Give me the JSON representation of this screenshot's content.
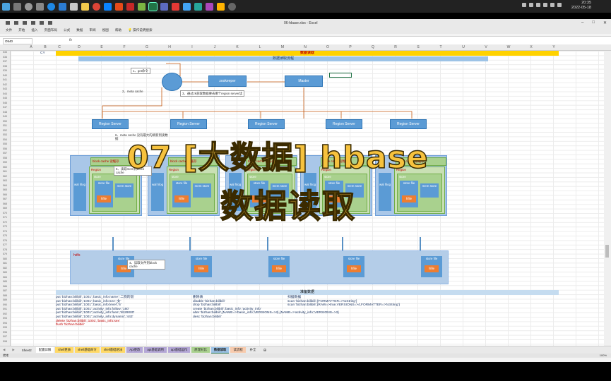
{
  "taskbar": {
    "clock_time": "20:35",
    "clock_date": "2022-05-18"
  },
  "title": {
    "filename": "06-hbase.xlsx",
    "app": "Excel"
  },
  "menu": [
    "文件",
    "开始",
    "插入",
    "页面布局",
    "公式",
    "数据",
    "审阅",
    "视图",
    "帮助",
    "操作说明搜索"
  ],
  "formula": {
    "namebox": "O540",
    "fx": "fx"
  },
  "columns": [
    "A",
    "B",
    "C",
    "D",
    "E",
    "F",
    "G",
    "H",
    "I",
    "J",
    "K",
    "L",
    "M",
    "N",
    "O",
    "P",
    "Q",
    "R",
    "S",
    "T",
    "U",
    "V",
    "W",
    "X",
    "Y"
  ],
  "rows_first": 535,
  "cell_cy": "CY",
  "diagram": {
    "top_title": "数据读取",
    "sub_title": "数据读取流程",
    "client": "",
    "zookeeper": "zookeeper",
    "master": "Master",
    "step1": "1、get命令",
    "step2": "2、meta cache",
    "step3": "3、通过zk获取数据要去哪个region server读",
    "step4": "4、读取文件到block cache",
    "step5": "5、读取mem到block cache",
    "step6": "6、meta cache 没有最大的刷新到读数据",
    "region_server": "Region Server",
    "block_cache": "block cache 读缓存",
    "region": "Region",
    "store": "store",
    "wal": "wal hlog",
    "store_file": "store file",
    "hfile": "hfile",
    "mem_store": "mem store",
    "hdfs": "hdfs"
  },
  "data_section": {
    "title": "准备数据",
    "col1": [
      "put 'bizhan:bilibili','1001','basic_info:name','二狗的饭'",
      "put 'bizhan:bilibili','1001','basic_info:sex','女'",
      "put 'bizhan:bilibili','1001','basic_info:level','6'",
      "put 'bizhan:bilibili','1001','activity_info:follow','160'",
      "put 'bizhan:bilibili','1001','activity_info:fans','4b29000'",
      "put 'bizhan:bilibili','1001','activity_info:dynamic','443'",
      "delete 'bizhan:bilibili','1001','basic_info:sex'",
      "flush 'bizhan:bilibili'"
    ],
    "col2": [
      "删除表",
      "disable 'bizhan:bilibili'",
      "drop 'bizhan:bilibili'",
      "create 'bizhan:bilibili','basic_info','activity_info'",
      "alter 'bizhan:bilibili',{NAME=>'basic_info',VERSIONS=>3},{NAME=>'activity_info',VERSIONS=>3}",
      "desc 'bizhan:bilibili'"
    ],
    "col3": [
      "扫描数据",
      "scan 'bizhan:bilibili',{FORMATTER=>'toString'}",
      "scan 'bizhan:bilibili',{RAW=>true,VERSIONS=>4,FORMATTER=>'toString'}"
    ]
  },
  "overlay": {
    "line1": "07 [大数据] hbase",
    "line2": "数据读取"
  },
  "sheet_tabs": [
    "Sheet2",
    "配置详解",
    "shell更表",
    "shell基础命令",
    "shell基础语法",
    "Api更改",
    "api基础调用",
    "api基础运作",
    "原理对比",
    "数据读取",
    "读流程",
    "补全"
  ],
  "status": {
    "left": "就绪",
    "zoom": "100%"
  }
}
